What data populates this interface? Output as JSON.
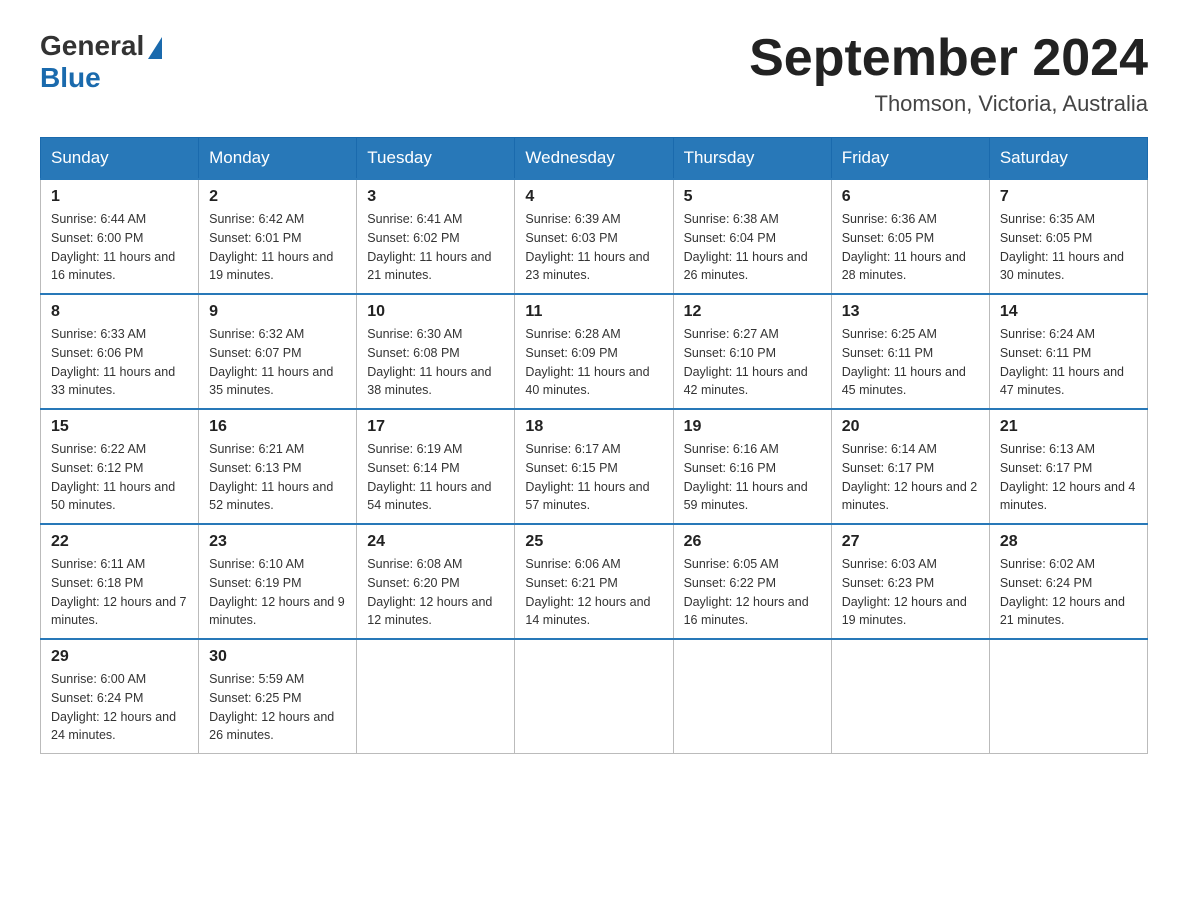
{
  "logo": {
    "general": "General",
    "blue": "Blue"
  },
  "title": {
    "month_year": "September 2024",
    "location": "Thomson, Victoria, Australia"
  },
  "weekdays": [
    "Sunday",
    "Monday",
    "Tuesday",
    "Wednesday",
    "Thursday",
    "Friday",
    "Saturday"
  ],
  "weeks": [
    [
      {
        "day": "1",
        "sunrise": "6:44 AM",
        "sunset": "6:00 PM",
        "daylight": "11 hours and 16 minutes."
      },
      {
        "day": "2",
        "sunrise": "6:42 AM",
        "sunset": "6:01 PM",
        "daylight": "11 hours and 19 minutes."
      },
      {
        "day": "3",
        "sunrise": "6:41 AM",
        "sunset": "6:02 PM",
        "daylight": "11 hours and 21 minutes."
      },
      {
        "day": "4",
        "sunrise": "6:39 AM",
        "sunset": "6:03 PM",
        "daylight": "11 hours and 23 minutes."
      },
      {
        "day": "5",
        "sunrise": "6:38 AM",
        "sunset": "6:04 PM",
        "daylight": "11 hours and 26 minutes."
      },
      {
        "day": "6",
        "sunrise": "6:36 AM",
        "sunset": "6:05 PM",
        "daylight": "11 hours and 28 minutes."
      },
      {
        "day": "7",
        "sunrise": "6:35 AM",
        "sunset": "6:05 PM",
        "daylight": "11 hours and 30 minutes."
      }
    ],
    [
      {
        "day": "8",
        "sunrise": "6:33 AM",
        "sunset": "6:06 PM",
        "daylight": "11 hours and 33 minutes."
      },
      {
        "day": "9",
        "sunrise": "6:32 AM",
        "sunset": "6:07 PM",
        "daylight": "11 hours and 35 minutes."
      },
      {
        "day": "10",
        "sunrise": "6:30 AM",
        "sunset": "6:08 PM",
        "daylight": "11 hours and 38 minutes."
      },
      {
        "day": "11",
        "sunrise": "6:28 AM",
        "sunset": "6:09 PM",
        "daylight": "11 hours and 40 minutes."
      },
      {
        "day": "12",
        "sunrise": "6:27 AM",
        "sunset": "6:10 PM",
        "daylight": "11 hours and 42 minutes."
      },
      {
        "day": "13",
        "sunrise": "6:25 AM",
        "sunset": "6:11 PM",
        "daylight": "11 hours and 45 minutes."
      },
      {
        "day": "14",
        "sunrise": "6:24 AM",
        "sunset": "6:11 PM",
        "daylight": "11 hours and 47 minutes."
      }
    ],
    [
      {
        "day": "15",
        "sunrise": "6:22 AM",
        "sunset": "6:12 PM",
        "daylight": "11 hours and 50 minutes."
      },
      {
        "day": "16",
        "sunrise": "6:21 AM",
        "sunset": "6:13 PM",
        "daylight": "11 hours and 52 minutes."
      },
      {
        "day": "17",
        "sunrise": "6:19 AM",
        "sunset": "6:14 PM",
        "daylight": "11 hours and 54 minutes."
      },
      {
        "day": "18",
        "sunrise": "6:17 AM",
        "sunset": "6:15 PM",
        "daylight": "11 hours and 57 minutes."
      },
      {
        "day": "19",
        "sunrise": "6:16 AM",
        "sunset": "6:16 PM",
        "daylight": "11 hours and 59 minutes."
      },
      {
        "day": "20",
        "sunrise": "6:14 AM",
        "sunset": "6:17 PM",
        "daylight": "12 hours and 2 minutes."
      },
      {
        "day": "21",
        "sunrise": "6:13 AM",
        "sunset": "6:17 PM",
        "daylight": "12 hours and 4 minutes."
      }
    ],
    [
      {
        "day": "22",
        "sunrise": "6:11 AM",
        "sunset": "6:18 PM",
        "daylight": "12 hours and 7 minutes."
      },
      {
        "day": "23",
        "sunrise": "6:10 AM",
        "sunset": "6:19 PM",
        "daylight": "12 hours and 9 minutes."
      },
      {
        "day": "24",
        "sunrise": "6:08 AM",
        "sunset": "6:20 PM",
        "daylight": "12 hours and 12 minutes."
      },
      {
        "day": "25",
        "sunrise": "6:06 AM",
        "sunset": "6:21 PM",
        "daylight": "12 hours and 14 minutes."
      },
      {
        "day": "26",
        "sunrise": "6:05 AM",
        "sunset": "6:22 PM",
        "daylight": "12 hours and 16 minutes."
      },
      {
        "day": "27",
        "sunrise": "6:03 AM",
        "sunset": "6:23 PM",
        "daylight": "12 hours and 19 minutes."
      },
      {
        "day": "28",
        "sunrise": "6:02 AM",
        "sunset": "6:24 PM",
        "daylight": "12 hours and 21 minutes."
      }
    ],
    [
      {
        "day": "29",
        "sunrise": "6:00 AM",
        "sunset": "6:24 PM",
        "daylight": "12 hours and 24 minutes."
      },
      {
        "day": "30",
        "sunrise": "5:59 AM",
        "sunset": "6:25 PM",
        "daylight": "12 hours and 26 minutes."
      },
      null,
      null,
      null,
      null,
      null
    ]
  ],
  "labels": {
    "sunrise": "Sunrise:",
    "sunset": "Sunset:",
    "daylight": "Daylight:"
  }
}
